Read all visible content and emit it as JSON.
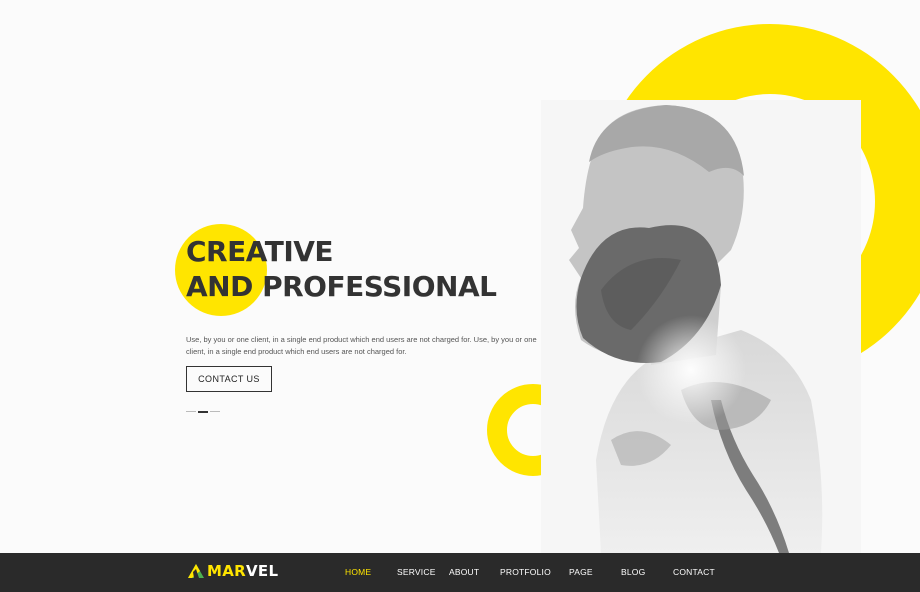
{
  "hero": {
    "heading_line1": "CREATIVE",
    "heading_line2": "AND PROFESSIONAL",
    "description": "Use, by you or one client, in a single end product which end users are not charged for. Use, by you or one client, in a single end product which end users are not charged for.",
    "button_label": "CONTACT US",
    "slider": {
      "count": 3,
      "active_index": 1
    }
  },
  "nav": {
    "logo_part1": "MAR",
    "logo_part2": "VEL",
    "items": [
      {
        "label": "HOME",
        "active": true
      },
      {
        "label": "SERVICE",
        "active": false
      },
      {
        "label": "ABOUT",
        "active": false
      },
      {
        "label": "PROTFOLIO",
        "active": false
      },
      {
        "label": "PAGE",
        "active": false
      },
      {
        "label": "BLOG",
        "active": false
      },
      {
        "label": "CONTACT",
        "active": false
      }
    ]
  },
  "colors": {
    "accent": "#ffe500",
    "nav_bg": "#2a2a2a",
    "text_dark": "#333333",
    "background": "#fbfbfb"
  },
  "icons": {
    "logo": "triangle-logo-icon"
  }
}
